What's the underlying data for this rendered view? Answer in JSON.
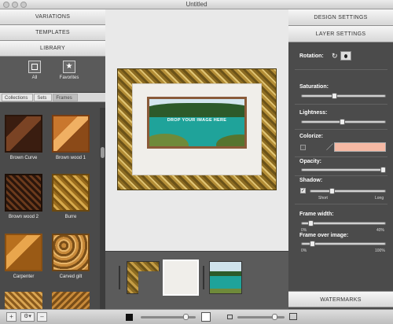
{
  "window": {
    "title": "Untitled"
  },
  "left": {
    "tabs": [
      "VARIATIONS",
      "TEMPLATES",
      "LIBRARY"
    ],
    "library_icons": [
      {
        "label": "All",
        "icon": "square-icon"
      },
      {
        "label": "Favorites",
        "icon": "star-icon"
      }
    ],
    "breadcrumbs": [
      "Collections",
      "Sets",
      "Frames"
    ],
    "frames": [
      {
        "name": "Brown Curve"
      },
      {
        "name": "Brown wood 1"
      },
      {
        "name": "Brown wood 2"
      },
      {
        "name": "Burre"
      },
      {
        "name": "Carpenter"
      },
      {
        "name": "Carved gilt"
      }
    ]
  },
  "canvas": {
    "drop_text": "DROP YOUR IMAGE HERE"
  },
  "right": {
    "design_settings": "DESIGN SETTINGS",
    "layer_settings": "LAYER SETTINGS",
    "rotation_label": "Rotation:",
    "saturation_label": "Saturation:",
    "lightness_label": "Lightness:",
    "colorize_label": "Colorize:",
    "opacity_label": "Opacity:",
    "shadow_label": "Shadow:",
    "short_label": "Short",
    "long_label": "Long",
    "frame_width_label": "Frame width:",
    "frame_width_min": "0%",
    "frame_width_max": "40%",
    "frame_over_label": "Frame over image:",
    "frame_over_min": "0%",
    "frame_over_max": "100%",
    "watermarks": "WATERMARKS",
    "colorize_swatch": "#f6b9a4"
  },
  "bottom": {
    "add": "+",
    "gear": "⚙▾",
    "remove": "–"
  }
}
